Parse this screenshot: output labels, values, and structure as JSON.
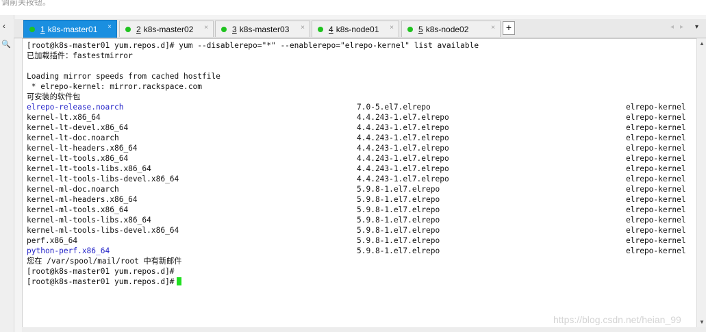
{
  "header_fragment": "调前关按钮。",
  "tabs": [
    {
      "num": "1",
      "label": "k8s-master01",
      "active": true
    },
    {
      "num": "2",
      "label": "k8s-master02",
      "active": false
    },
    {
      "num": "3",
      "label": "k8s-master03",
      "active": false
    },
    {
      "num": "4",
      "label": "k8s-node01",
      "active": false
    },
    {
      "num": "5",
      "label": "k8s-node02",
      "active": false
    }
  ],
  "tab_close_glyph": "×",
  "add_tab_glyph": "+",
  "colors": {
    "active_tab": "#1a8fe0",
    "status_dot": "#1fc31f",
    "cursor": "#20e020",
    "highlight_text": "#2323c8"
  },
  "terminal": {
    "command_line": "[root@k8s-master01 yum.repos.d]# yum --disablerepo=\"*\" --enablerepo=\"elrepo-kernel\" list available",
    "plugins_line": "已加载插件：fastestmirror",
    "mirror_line": "Loading mirror speeds from cached hostfile",
    "mirror_item": " * elrepo-kernel: mirror.rackspace.com",
    "available_header": "可安装的软件包",
    "packages": [
      {
        "name": "elrepo-release.noarch",
        "version": "7.0-5.el7.elrepo",
        "repo": "elrepo-kernel",
        "highlight": true
      },
      {
        "name": "kernel-lt.x86_64",
        "version": "4.4.243-1.el7.elrepo",
        "repo": "elrepo-kernel",
        "highlight": false
      },
      {
        "name": "kernel-lt-devel.x86_64",
        "version": "4.4.243-1.el7.elrepo",
        "repo": "elrepo-kernel",
        "highlight": false
      },
      {
        "name": "kernel-lt-doc.noarch",
        "version": "4.4.243-1.el7.elrepo",
        "repo": "elrepo-kernel",
        "highlight": false
      },
      {
        "name": "kernel-lt-headers.x86_64",
        "version": "4.4.243-1.el7.elrepo",
        "repo": "elrepo-kernel",
        "highlight": false
      },
      {
        "name": "kernel-lt-tools.x86_64",
        "version": "4.4.243-1.el7.elrepo",
        "repo": "elrepo-kernel",
        "highlight": false
      },
      {
        "name": "kernel-lt-tools-libs.x86_64",
        "version": "4.4.243-1.el7.elrepo",
        "repo": "elrepo-kernel",
        "highlight": false
      },
      {
        "name": "kernel-lt-tools-libs-devel.x86_64",
        "version": "4.4.243-1.el7.elrepo",
        "repo": "elrepo-kernel",
        "highlight": false
      },
      {
        "name": "kernel-ml-doc.noarch",
        "version": "5.9.8-1.el7.elrepo",
        "repo": "elrepo-kernel",
        "highlight": false
      },
      {
        "name": "kernel-ml-headers.x86_64",
        "version": "5.9.8-1.el7.elrepo",
        "repo": "elrepo-kernel",
        "highlight": false
      },
      {
        "name": "kernel-ml-tools.x86_64",
        "version": "5.9.8-1.el7.elrepo",
        "repo": "elrepo-kernel",
        "highlight": false
      },
      {
        "name": "kernel-ml-tools-libs.x86_64",
        "version": "5.9.8-1.el7.elrepo",
        "repo": "elrepo-kernel",
        "highlight": false
      },
      {
        "name": "kernel-ml-tools-libs-devel.x86_64",
        "version": "5.9.8-1.el7.elrepo",
        "repo": "elrepo-kernel",
        "highlight": false
      },
      {
        "name": "perf.x86_64",
        "version": "5.9.8-1.el7.elrepo",
        "repo": "elrepo-kernel",
        "highlight": false
      },
      {
        "name": "python-perf.x86_64",
        "version": "5.9.8-1.el7.elrepo",
        "repo": "elrepo-kernel",
        "highlight": true
      }
    ],
    "mail_line": "您在 /var/spool/mail/root 中有新邮件",
    "prompt_line": "[root@k8s-master01 yum.repos.d]#",
    "prompt_line_2": "[root@k8s-master01 yum.repos.d]#"
  },
  "watermark": "https://blog.csdn.net/heian_99"
}
